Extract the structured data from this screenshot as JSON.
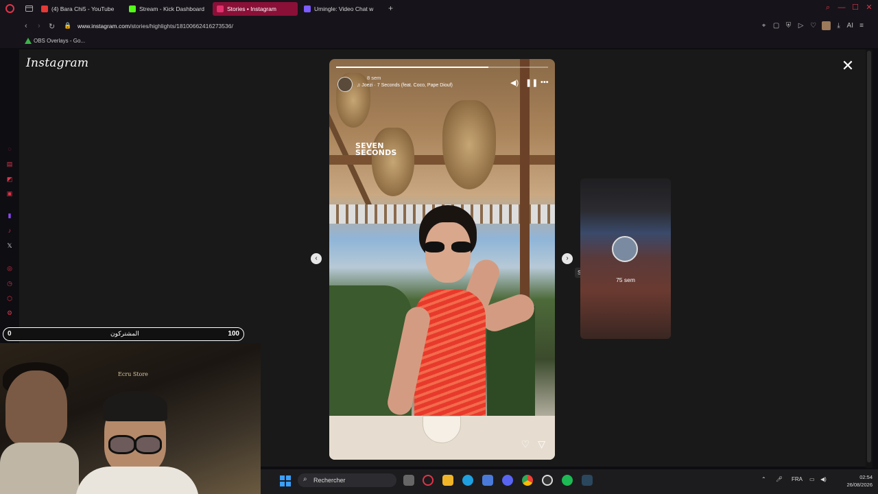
{
  "browser": {
    "tabs": [
      {
        "label": "(4) Bara Chi5 - YouTube",
        "color": "#e53935"
      },
      {
        "label": "Stream - Kick Dashboard",
        "color": "#53fc18"
      },
      {
        "label": "Stories • Instagram",
        "color": "#e1306c",
        "active": true
      },
      {
        "label": "Umingle: Video Chat w",
        "color": "#7b5cff"
      }
    ],
    "new_tab": "+",
    "url_host": "www.instagram.com",
    "url_path": "/stories/highlights/18100662416273536/",
    "bookmark": "OBS Overlays - Go...",
    "extension_label": "AI"
  },
  "instagram": {
    "logo": "Instagram",
    "story": {
      "time": "8 sem",
      "song": "Joezi · 7 Seconds (feat. Coco, Pape Diouf)",
      "sticker_line1": "SEVEN",
      "sticker_line2": "SECONDS",
      "progress": 0.72
    },
    "next_preview": {
      "time": "75 sem"
    },
    "tooltip": "Suivant"
  },
  "overlay": {
    "sub_left": "0",
    "sub_label": "المشتركون",
    "sub_right": "100",
    "cam_sign": "Ecru Store"
  },
  "taskbar": {
    "search_placeholder": "Rechercher",
    "lang": "FRA",
    "time": "02:54",
    "date": "26/08/2026"
  },
  "colors": {
    "accent": "#e0354a",
    "active_tab": "#8a1038"
  }
}
